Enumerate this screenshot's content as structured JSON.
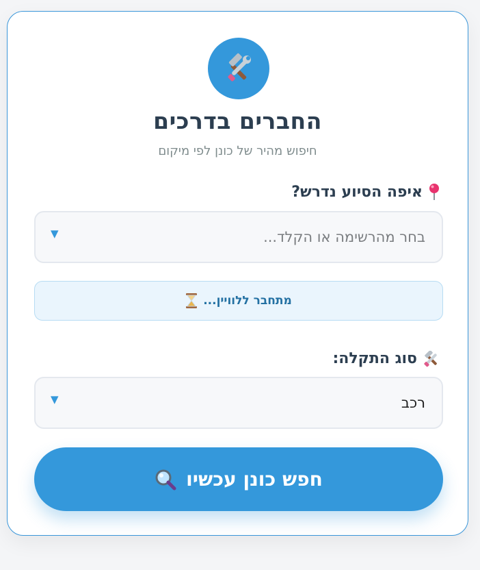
{
  "app": {
    "title": "החברים בדרכים",
    "subtitle": "חיפוש מהיר של כונן לפי מיקום",
    "logo_icon": "tools-icon"
  },
  "location": {
    "label": "איפה הסיוע נדרש?",
    "icon": "pin-icon",
    "placeholder": "בחר מהרשימה או הקלד..."
  },
  "status": {
    "text": "מתחבר ללוויין...",
    "icon": "hourglass-icon"
  },
  "issue": {
    "label": "סוג התקלה:",
    "icon": "tools-icon",
    "value": "רכב"
  },
  "search_button": {
    "label": "חפש כונן עכשיו",
    "icon": "magnifier-icon"
  },
  "colors": {
    "primary": "#3498db",
    "title": "#2c3e50",
    "status_bg": "#eaf5fd"
  }
}
